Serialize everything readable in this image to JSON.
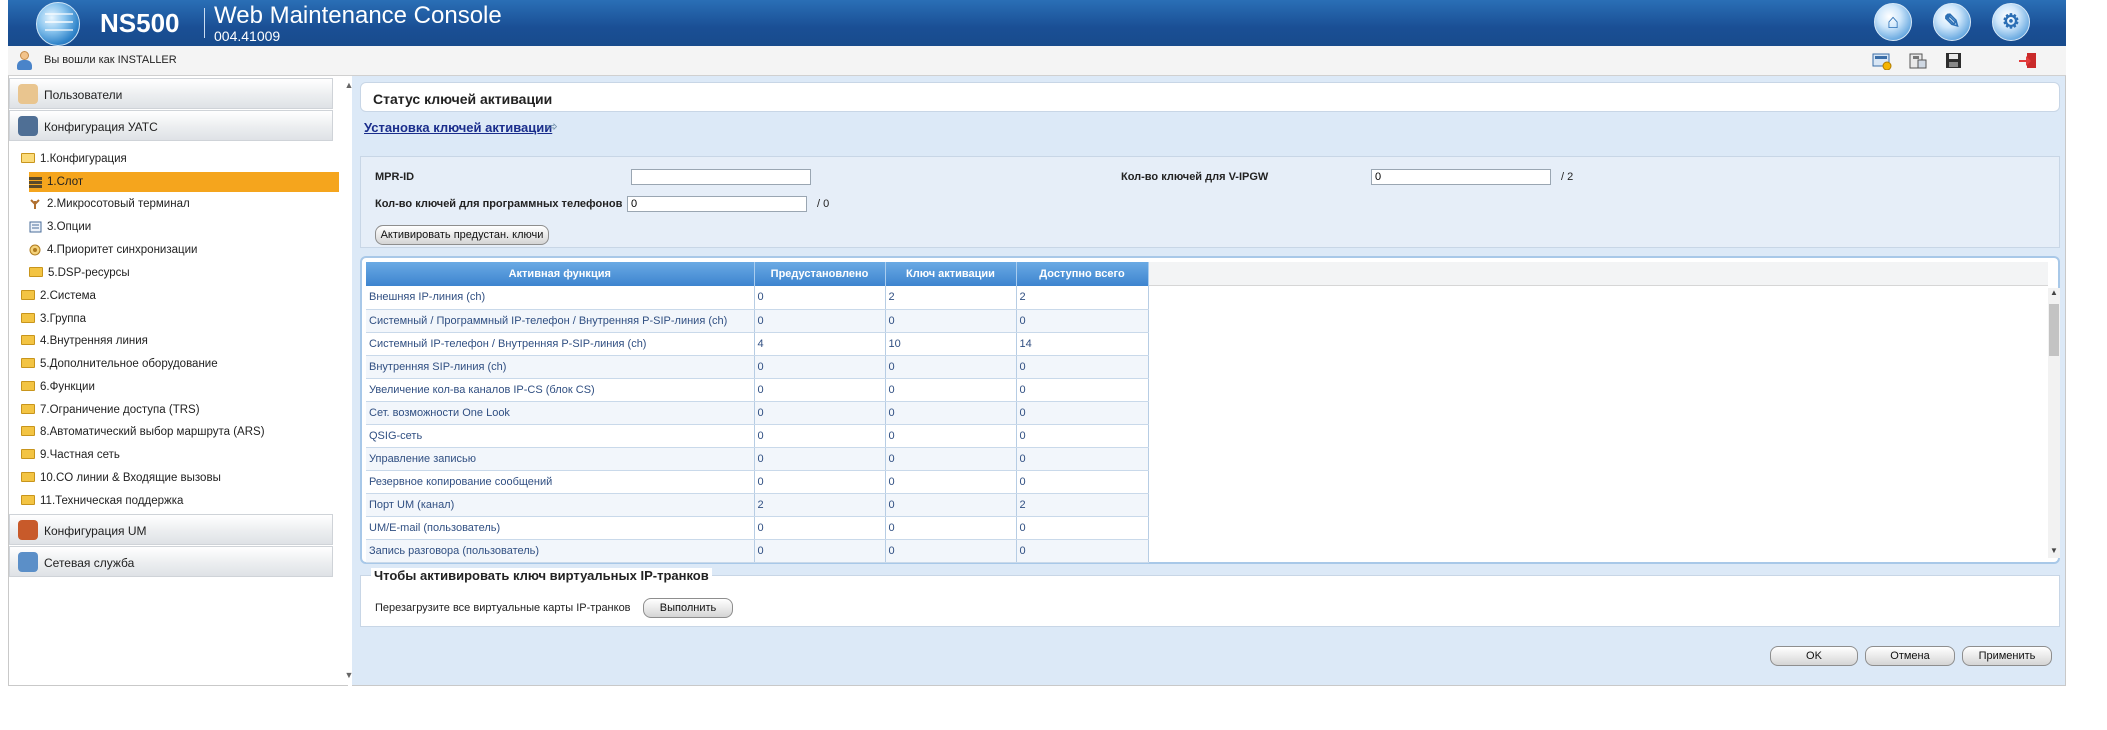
{
  "header": {
    "model": "NS500",
    "title": "Web Maintenance Console",
    "version": "004.41009",
    "buttons": [
      {
        "name": "home-icon",
        "glyph": "⌂"
      },
      {
        "name": "wrench-icon",
        "glyph": "✎"
      },
      {
        "name": "settings-icon",
        "glyph": "⚙"
      }
    ]
  },
  "userbar": {
    "logged_in_text": "Вы вошли как INSTALLER",
    "tools": [
      "system-alert-icon",
      "phone-list-icon",
      "save-icon",
      "logout-icon"
    ]
  },
  "sidebar": {
    "sections": [
      {
        "label": "Пользователи"
      },
      {
        "label": "Конфигурация УАТС"
      },
      {
        "label": "Конфигурация UM"
      },
      {
        "label": "Сетевая служба"
      }
    ],
    "tree": [
      {
        "label": "1.Конфигурация",
        "type": "folder-open"
      },
      {
        "label": "1.Слот",
        "type": "leaf",
        "selected": true
      },
      {
        "label": "2.Микросотовый терминал",
        "type": "leaf"
      },
      {
        "label": "3.Опции",
        "type": "leaf"
      },
      {
        "label": "4.Приоритет синхронизации",
        "type": "leaf"
      },
      {
        "label": "5.DSP-ресурсы",
        "type": "folder"
      },
      {
        "label": "2.Система",
        "type": "folder"
      },
      {
        "label": "3.Группа",
        "type": "folder"
      },
      {
        "label": "4.Внутренняя линия",
        "type": "folder"
      },
      {
        "label": "5.Дополнительное оборудование",
        "type": "folder"
      },
      {
        "label": "6.Функции",
        "type": "folder"
      },
      {
        "label": "7.Ограничение доступа (TRS)",
        "type": "folder"
      },
      {
        "label": "8.Автоматический выбор маршрута (ARS)",
        "type": "folder"
      },
      {
        "label": "9.Частная сеть",
        "type": "folder"
      },
      {
        "label": "10.CO линии & Входящие вызовы",
        "type": "folder"
      },
      {
        "label": "11.Техническая поддержка",
        "type": "folder"
      }
    ]
  },
  "main": {
    "title": "Статус ключей активации",
    "install_link": "Установка ключей активации",
    "form": {
      "mpr_label": "MPR-ID",
      "mpr_value": "",
      "vipgw_label": "Кол-во ключей для V-IPGW",
      "vipgw_value": "0",
      "vipgw_suffix": "/ 2",
      "softphone_label": "Кол-во ключей для программных телефонов",
      "softphone_value": "0",
      "softphone_suffix": "/ 0",
      "activate_button": "Активировать предустан. ключи"
    },
    "table": {
      "columns": [
        "Активная функция",
        "Предустановлено",
        "Ключ активации",
        "Доступно всего"
      ],
      "rows": [
        [
          "Внешняя IP-линия (ch)",
          "0",
          "2",
          "2"
        ],
        [
          "Системный / Программный IP-телефон / Внутренняя P-SIP-линия (ch)",
          "0",
          "0",
          "0"
        ],
        [
          "Системный IP-телефон /  Внутренняя P-SIP-линия (ch)",
          "4",
          "10",
          "14"
        ],
        [
          "Внутренняя SIP-линия (ch)",
          "0",
          "0",
          "0"
        ],
        [
          "Увеличение кол-ва каналов IP-CS (блок CS)",
          "0",
          "0",
          "0"
        ],
        [
          "Сет. возможности One Look",
          "0",
          "0",
          "0"
        ],
        [
          "QSIG-сеть",
          "0",
          "0",
          "0"
        ],
        [
          "Управление записью",
          "0",
          "0",
          "0"
        ],
        [
          "Резервное копирование сообщений",
          "0",
          "0",
          "0"
        ],
        [
          "Порт UM (канал)",
          "2",
          "0",
          "2"
        ],
        [
          "UM/E-mail (пользователь)",
          "0",
          "0",
          "0"
        ],
        [
          "Запись разговора (пользователь)",
          "0",
          "0",
          "0"
        ]
      ]
    },
    "virtual": {
      "legend": "Чтобы активировать ключ виртуальных IP-транков",
      "text": "Перезагрузите все виртуальные карты IP-транков",
      "button": "Выполнить"
    },
    "footer": {
      "ok": "OK",
      "cancel": "Отмена",
      "apply": "Применить"
    }
  }
}
